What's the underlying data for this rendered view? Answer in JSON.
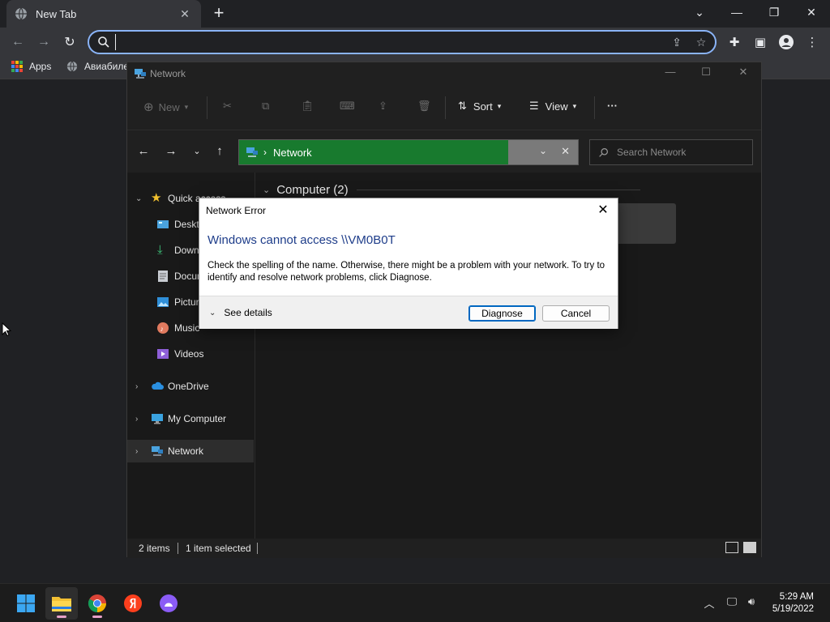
{
  "browser": {
    "tab_title": "New Tab",
    "address_value": "",
    "bookmarks": [
      {
        "label": "Apps"
      },
      {
        "label": "Авиабиле"
      }
    ]
  },
  "explorer": {
    "window_title": "Network",
    "command_bar": {
      "new_label": "New",
      "sort_label": "Sort",
      "view_label": "View",
      "more_label": "···"
    },
    "address": {
      "location": "Network",
      "search_placeholder": "Search Network"
    },
    "nav_pane": {
      "quick_access": "Quick access",
      "items": [
        {
          "label": "Desktop"
        },
        {
          "label": "Downloads"
        },
        {
          "label": "Documents"
        },
        {
          "label": "Pictures"
        },
        {
          "label": "Music"
        },
        {
          "label": "Videos"
        }
      ],
      "onedrive": "OneDrive",
      "my_computer": "My Computer",
      "network": "Network"
    },
    "content": {
      "group_header": "Computer (2)"
    },
    "status": {
      "items_count": "2 items",
      "selected": "1 item selected"
    }
  },
  "dialog": {
    "title": "Network Error",
    "heading": "Windows cannot access \\\\VM0B0T",
    "message": "Check the spelling of the name. Otherwise, there might be a problem with your network. To try to identify and resolve network problems, click Diagnose.",
    "see_details": "See details",
    "diagnose_label": "Diagnose",
    "cancel_label": "Cancel"
  },
  "taskbar": {
    "time": "5:29 AM",
    "date": "5/19/2022"
  },
  "colors": {
    "address_highlight": "#187a2e",
    "dialog_heading": "#1e3d8a",
    "omnibox_focus": "#8ab4f8"
  }
}
